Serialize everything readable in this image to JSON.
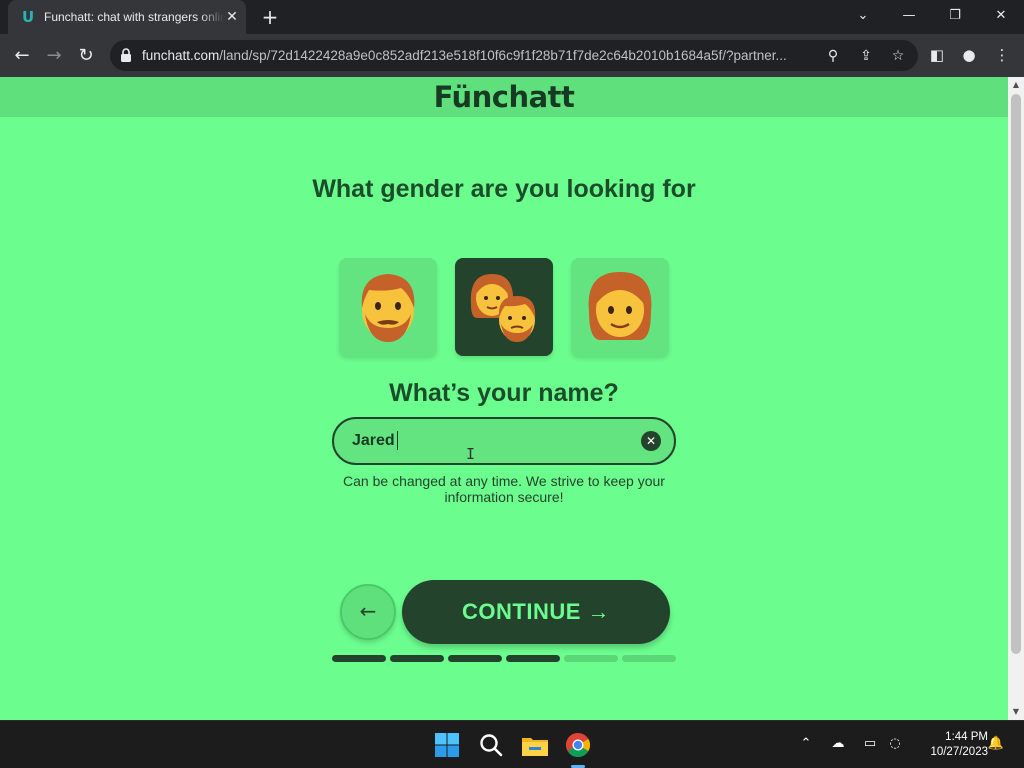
{
  "browser": {
    "tab_title": "Funchatt: chat with strangers online",
    "tab_favicon": "U",
    "tab_close": "✕",
    "new_tab": "+",
    "url_host": "funchatt.com",
    "url_path": "/land/sp/72d1422428a9e0c852adf213e518f10f6c9f1f28b71f7de2c64b2010b1684a5f/?partner...",
    "icons": [
      "favicon-icon",
      "close-icon",
      "plus-icon",
      "chevron-down-icon",
      "minimize-icon",
      "restore-icon",
      "window-close-icon",
      "back-arrow-icon",
      "forward-arrow-icon",
      "reload-icon",
      "lock-icon",
      "zoom-icon",
      "share-icon",
      "star-icon",
      "side-panel-icon",
      "profile-icon",
      "menu-icon"
    ]
  },
  "page": {
    "logo": "Fünchatt",
    "gender_question": "What gender are you looking for",
    "gender_options": [
      {
        "label": "male",
        "icon": "man-emoji-icon",
        "selected": false
      },
      {
        "label": "both",
        "icon": "couple-emoji-icon",
        "selected": true
      },
      {
        "label": "female",
        "icon": "woman-emoji-icon",
        "selected": false
      }
    ],
    "name_question": "What’s your name?",
    "name_value": "Jared",
    "clear_symbol": "✕",
    "helper_text": "Can be changed at any time. We strive to keep your information secure!",
    "back_label": "←",
    "continue_label": "CONTINUE →",
    "progress": {
      "total_steps": 6,
      "completed_steps": 4
    }
  },
  "taskbar": {
    "time": "1:44 PM",
    "date": "10/27/2023",
    "icons": [
      "windows-start-icon",
      "search-icon",
      "file-explorer-icon",
      "chrome-icon",
      "chevron-up-icon",
      "onedrive-icon",
      "display-icon",
      "network-volume-icon",
      "notification-bell-icon"
    ]
  },
  "colors": {
    "page_background": "#6cfd8f",
    "header_background": "#5fe07c",
    "dark_green": "#24432d",
    "text_green": "#1b4d2a"
  }
}
